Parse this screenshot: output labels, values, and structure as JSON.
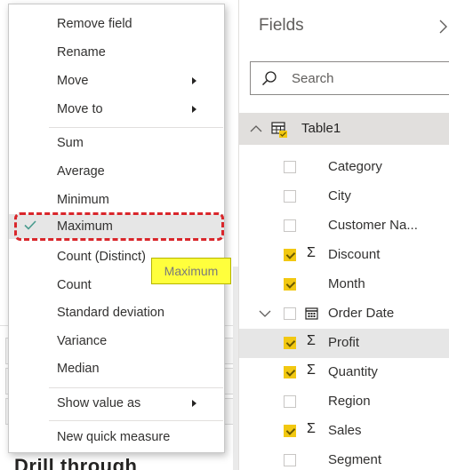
{
  "context_menu": {
    "items": [
      {
        "label": "Remove field",
        "submenu": false
      },
      {
        "label": "Rename",
        "submenu": false
      },
      {
        "label": "Move",
        "submenu": true
      },
      {
        "label": "Move to",
        "submenu": true
      },
      {
        "label": "Sum",
        "submenu": false
      },
      {
        "label": "Average",
        "submenu": false
      },
      {
        "label": "Minimum",
        "submenu": false
      },
      {
        "label": "Maximum",
        "submenu": false,
        "checked": true
      },
      {
        "label": "Count (Distinct)",
        "submenu": false
      },
      {
        "label": "Count",
        "submenu": false
      },
      {
        "label": "Standard deviation",
        "submenu": false
      },
      {
        "label": "Variance",
        "submenu": false
      },
      {
        "label": "Median",
        "submenu": false
      },
      {
        "label": "Show value as",
        "submenu": true
      },
      {
        "label": "New quick measure",
        "submenu": false
      }
    ],
    "checked_item": "Maximum"
  },
  "tooltip": {
    "text": "Maximum"
  },
  "canvas": {
    "drill_label": "Drill through"
  },
  "fields_pane": {
    "title": "Fields",
    "search_placeholder": "Search",
    "table": {
      "name": "Table1",
      "expanded": true
    },
    "fields": [
      {
        "name": "Category",
        "checked": false,
        "type": ""
      },
      {
        "name": "City",
        "checked": false,
        "type": ""
      },
      {
        "name": "Customer Na...",
        "checked": false,
        "type": ""
      },
      {
        "name": "Discount",
        "checked": true,
        "type": "Σ"
      },
      {
        "name": "Month",
        "checked": true,
        "type": ""
      },
      {
        "name": "Order Date",
        "checked": false,
        "type": "calendar",
        "expandable": true
      },
      {
        "name": "Profit",
        "checked": true,
        "type": "Σ",
        "selected": true
      },
      {
        "name": "Quantity",
        "checked": true,
        "type": "Σ"
      },
      {
        "name": "Region",
        "checked": false,
        "type": ""
      },
      {
        "name": "Sales",
        "checked": true,
        "type": "Σ"
      },
      {
        "name": "Segment",
        "checked": false,
        "type": ""
      }
    ]
  },
  "colors": {
    "accent_yellow": "#f2c811",
    "highlight_red": "#d9262b",
    "tooltip_yellow": "#ffff3c",
    "check_teal": "#4a9b8e"
  }
}
